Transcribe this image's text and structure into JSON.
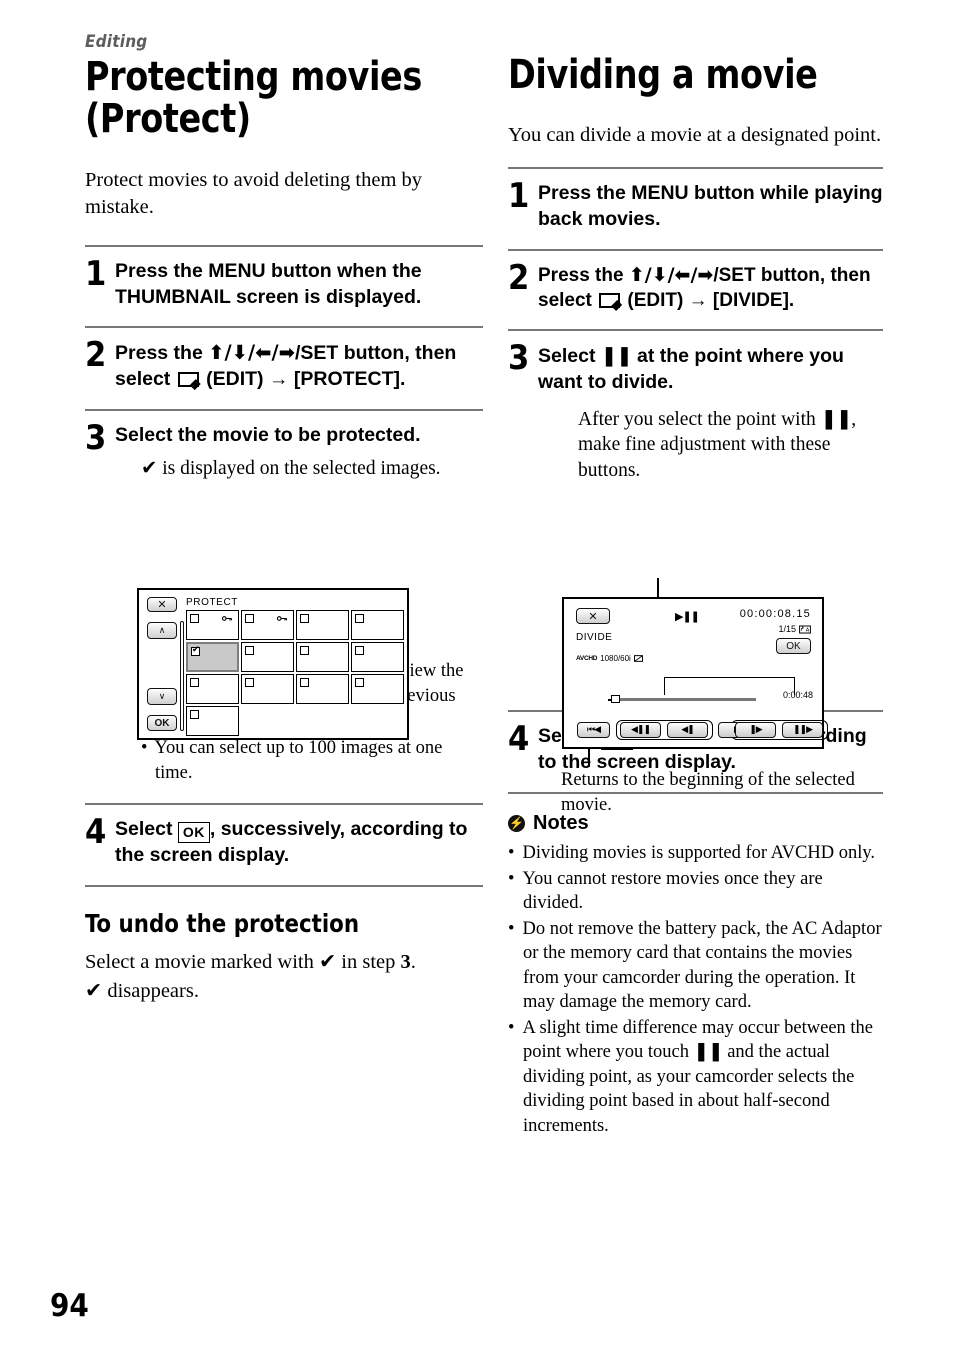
{
  "page": {
    "number": "94",
    "kicker": "Editing"
  },
  "left": {
    "title": "Protecting movies (Protect)",
    "intro": "Protect movies to avoid deleting them by mistake.",
    "steps": [
      {
        "num": "1",
        "text": "Press the MENU button when the THUMBNAIL screen is displayed."
      },
      {
        "num": "2",
        "pre": "Press the ",
        "keys": "⬆/⬇/⬅/➡",
        "mid": "/SET button, then select ",
        "icon": "edit-icon",
        "post": " (EDIT) → [PROTECT]."
      },
      {
        "num": "3",
        "text": "Select the movie to be protected.",
        "sub_check": "✔",
        "sub": " is displayed on the selected images."
      },
      {
        "num": "4",
        "pre": "Select ",
        "chip": "OK",
        "post": ", successively, according to the screen display."
      }
    ],
    "bullets": [
      {
        "pre": "Press the DISPLAY button to preview the image. Press ",
        "chip": "✕",
        "post": " to return to the previous screen."
      },
      {
        "pre": "You can select up to 100 images at one time."
      }
    ],
    "undo_heading": "To undo the protection",
    "undo_text_1": "Select a movie marked with ",
    "undo_check": "✔",
    "undo_text_2": " in step ",
    "undo_step": "3",
    "undo_text_3": ". ",
    "undo_text_4": " disappears."
  },
  "protect_screen": {
    "title": "PROTECT",
    "close_label": "✕",
    "up_label": "∧",
    "down_label": "∨",
    "ok_label": "OK",
    "rows": [
      [
        {
          "checked": false,
          "key": true
        },
        {
          "checked": false,
          "key": true
        },
        {
          "checked": false,
          "key": false
        },
        {
          "checked": false,
          "key": false
        }
      ],
      [
        {
          "checked": true,
          "key": false,
          "selected": true
        },
        {
          "checked": false,
          "key": false
        },
        {
          "checked": false,
          "key": false
        },
        {
          "checked": false,
          "key": false
        }
      ],
      [
        {
          "checked": false,
          "key": false
        },
        {
          "checked": false,
          "key": false
        },
        {
          "checked": false,
          "key": false
        },
        {
          "checked": false,
          "key": false
        }
      ],
      [
        {
          "checked": false,
          "key": false
        }
      ]
    ]
  },
  "right": {
    "title": "Dividing a movie",
    "intro": "You can divide a movie at a designated point.",
    "steps": [
      {
        "num": "1",
        "text": "Press the MENU button while playing back movies."
      },
      {
        "num": "2",
        "pre": "Press the ",
        "keys": "⬆/⬇/⬅/➡",
        "mid": "/SET button, then select ",
        "icon": "edit-icon",
        "post": " (EDIT) → [DIVIDE]."
      },
      {
        "num": "3",
        "pre": "Select ",
        "pause": "❚❚",
        "post": " at the point where you want to divide.",
        "sub_pre": "After you select the point with ",
        "sub_pause": "❚❚",
        "sub_post": ", make fine adjustment with these buttons."
      },
      {
        "num": "4",
        "pre": "Select ",
        "chip": "OK",
        "post": ", successively, according to the screen display."
      }
    ],
    "figure_caption": "Returns to the beginning of the selected movie.",
    "notes_heading": "Notes",
    "notes_icon": "notes-icon",
    "notes": [
      {
        "text": "Dividing movies is supported for AVCHD only."
      },
      {
        "text": "You cannot restore movies once they are divided."
      },
      {
        "text": "Do not remove the battery pack, the AC Adaptor or the memory card that contains the movies from your camcorder during the operation. It may damage the memory card."
      },
      {
        "pre": "A slight time difference may occur between the point where you touch ",
        "pause": "❚❚",
        "post": " and the actual dividing point, as your camcorder selects the dividing point based in about half-second increments."
      }
    ]
  },
  "divide_screen": {
    "close_label": "✕",
    "mode_label": "DIVIDE",
    "format_label": "AVCHD",
    "format_value": "1080/60i",
    "play_pause": "▶❚❚",
    "timecode": "00:00:08.15",
    "counter": "1/15",
    "ok_label": "OK",
    "duration": "0:00:48",
    "transport": [
      {
        "name": "return-to-beginning-button",
        "label": "⏮◀"
      },
      {
        "name": "frame-back-pause-button",
        "label": "◀❚❚"
      },
      {
        "name": "step-back-button",
        "label": "◀❚"
      },
      {
        "name": "play-button",
        "label": "▶"
      },
      {
        "name": "step-forward-button",
        "label": "❚▶"
      },
      {
        "name": "frame-forward-button",
        "label": "❚❚▶"
      }
    ]
  }
}
